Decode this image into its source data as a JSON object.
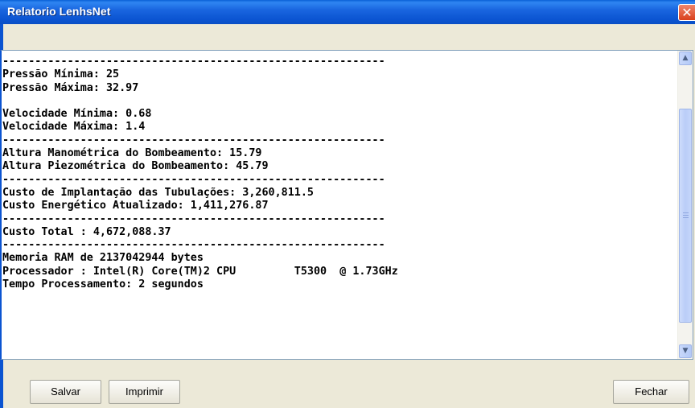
{
  "window": {
    "title": "Relatorio LenhsNet",
    "close_glyph": "✕"
  },
  "report": {
    "lines": [
      "-----------------------------------------------------------",
      "Pressão Mínima: 25",
      "Pressão Máxima: 32.97",
      "",
      "Velocidade Mínima: 0.68",
      "Velocidade Máxima: 1.4",
      "-----------------------------------------------------------",
      "Altura Manométrica do Bombeamento: 15.79",
      "Altura Piezométrica do Bombeamento: 45.79",
      "-----------------------------------------------------------",
      "Custo de Implantação das Tubulações: 3,260,811.5",
      "Custo Energético Atualizado: 1,411,276.87",
      "-----------------------------------------------------------",
      "Custo Total : 4,672,088.37",
      "-----------------------------------------------------------",
      "Memoria RAM de 2137042944 bytes",
      "Processador : Intel(R) Core(TM)2 CPU         T5300  @ 1.73GHz",
      "Tempo Processamento: 2 segundos"
    ]
  },
  "scrollbar": {
    "up_glyph": "▲",
    "down_glyph": "▼"
  },
  "buttons": {
    "save": "Salvar",
    "print": "Imprimir",
    "close": "Fechar"
  }
}
